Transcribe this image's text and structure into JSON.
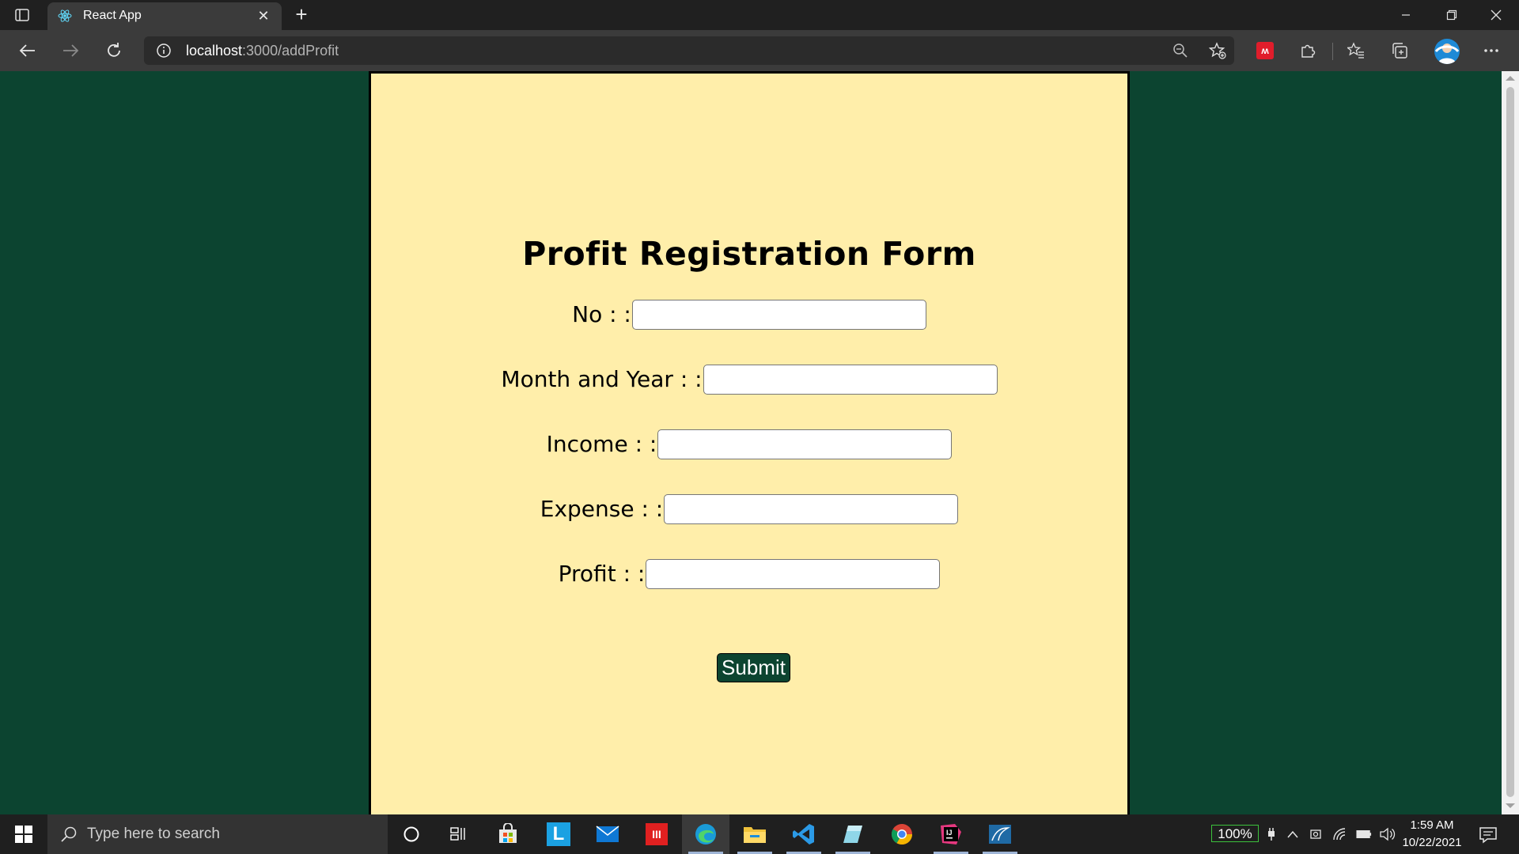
{
  "browser": {
    "tab_title": "React App",
    "url_host": "localhost",
    "url_path": ":3000/addProfit"
  },
  "form": {
    "title": "Profit Registration Form",
    "fields": [
      {
        "label": "No : :",
        "value": ""
      },
      {
        "label": "Month and Year : :",
        "value": ""
      },
      {
        "label": "Income : :",
        "value": ""
      },
      {
        "label": "Expense : :",
        "value": ""
      },
      {
        "label": "Profit : :",
        "value": ""
      }
    ],
    "submit_label": "Submit"
  },
  "taskbar": {
    "search_placeholder": "Type here to search",
    "battery_percent": "100%",
    "time": "1:59 AM",
    "date": "10/22/2021"
  },
  "colors": {
    "page_background": "#0c4430",
    "form_background": "#ffeeaa",
    "submit_background": "#0c4430"
  }
}
